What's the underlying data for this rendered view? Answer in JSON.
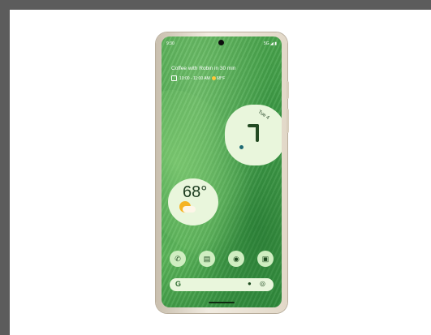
{
  "status": {
    "time": "9:30",
    "signal": "5G ◢ ▮"
  },
  "glance": {
    "event": "Coffee with Robin in 30 min",
    "detail": "10:00 - 11:00 AM",
    "temp_small": "68°F"
  },
  "clock": {
    "date": "Tue 4"
  },
  "weather": {
    "temp": "68°"
  },
  "dock": {
    "apps": [
      "phone-icon",
      "messages-icon",
      "chrome-icon",
      "camera-icon"
    ]
  },
  "search": {
    "logo": "G"
  }
}
